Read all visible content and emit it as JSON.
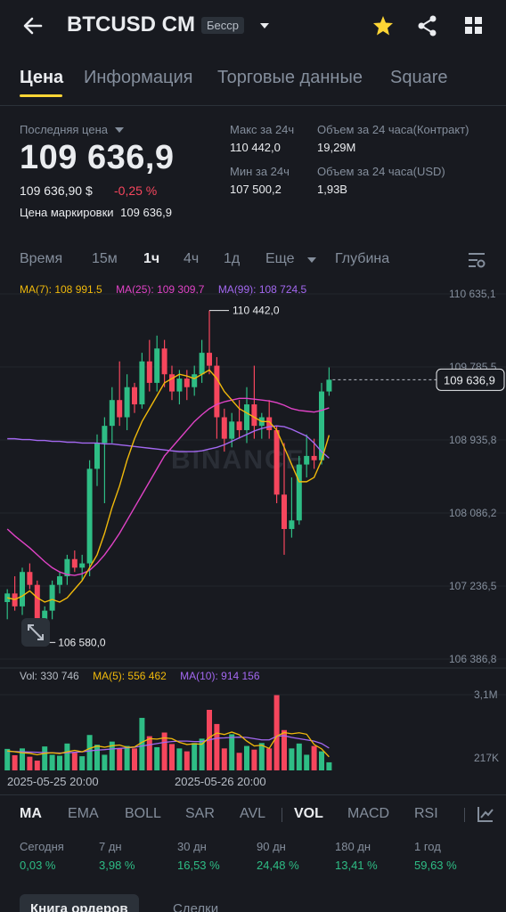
{
  "header": {
    "title": "BTCUSD CM",
    "badge": "Бесср"
  },
  "tabs": [
    "Цена",
    "Информация",
    "Торговые данные",
    "Square"
  ],
  "stats": {
    "last_price_label": "Последняя цена",
    "last_price": "109 636,9",
    "price_usd": "109 636,90 $",
    "change": "-0,25 %",
    "mark_label": "Цена маркировки",
    "mark_value": "109 636,9",
    "high_label": "Макс за 24ч",
    "high_value": "110 442,0",
    "low_label": "Мин за 24ч",
    "low_value": "107 500,2",
    "vol_contract_label": "Объем за 24 часа(Контракт)",
    "vol_contract_value": "19,29M",
    "vol_usd_label": "Объем за 24 часа(USD)",
    "vol_usd_value": "1,93B"
  },
  "timeframes": [
    "Время",
    "15м",
    "1ч",
    "4ч",
    "1д",
    "Еще",
    "Глубина"
  ],
  "active_timeframe": "1ч",
  "ma_legend": {
    "ma7": "MA(7): 108 991,5",
    "ma25": "MA(25): 109 309,7",
    "ma99": "MA(99): 108 724,5"
  },
  "watermark": "BINANCE",
  "vol_legend": {
    "vol": "Vol: 330 746",
    "ma5": "MA(5): 556 462",
    "ma10": "MA(10): 914 156"
  },
  "dates": [
    "2025-05-25 20:00",
    "2025-05-26 20:00"
  ],
  "indicators": [
    "MA",
    "EMA",
    "BOLL",
    "SAR",
    "AVL",
    "VOL",
    "MACD",
    "RSI"
  ],
  "performance": [
    {
      "label": "Сегодня",
      "value": "0,03 %"
    },
    {
      "label": "7 дн",
      "value": "3,98 %"
    },
    {
      "label": "30 дн",
      "value": "16,53 %"
    },
    {
      "label": "90 дн",
      "value": "24,48 %"
    },
    {
      "label": "180 дн",
      "value": "13,41 %"
    },
    {
      "label": "1 год",
      "value": "59,63 %"
    }
  ],
  "bottom_tabs": [
    "Книга ордеров",
    "Сделки"
  ],
  "colors": {
    "up": "#2ebd85",
    "down": "#f6465d",
    "ma7": "#f0b90b",
    "ma25": "#e043c6",
    "ma99": "#a368f0",
    "accent": "#fcd535"
  },
  "chart_data": {
    "type": "candlestick",
    "title": "",
    "price_axis_labels": [
      "110 635,1",
      "109 785,5",
      "108 935,8",
      "108 086,2",
      "107 236,5",
      "106 386,8"
    ],
    "price_axis_values": [
      110635.1,
      109785.5,
      108935.8,
      108086.2,
      107236.5,
      106386.8
    ],
    "current_price_label": "109 636,9",
    "current_price": 109636.9,
    "high_annotation": "110 442,0",
    "high_value": 110442.0,
    "low_annotation": "106 580,0",
    "low_value": 106580.0,
    "volume_axis_labels": [
      "3,1M",
      "217K"
    ],
    "volume_axis_values": [
      3100000,
      217000
    ],
    "candles": [
      {
        "o": 107050,
        "h": 107200,
        "l": 106850,
        "c": 107150
      },
      {
        "o": 107150,
        "h": 107350,
        "l": 106950,
        "c": 107000
      },
      {
        "o": 107000,
        "h": 107450,
        "l": 106900,
        "c": 107400
      },
      {
        "o": 107400,
        "h": 107500,
        "l": 107200,
        "c": 107250
      },
      {
        "o": 107250,
        "h": 107300,
        "l": 106650,
        "c": 106750
      },
      {
        "o": 106750,
        "h": 107000,
        "l": 106580,
        "c": 106950
      },
      {
        "o": 106950,
        "h": 107300,
        "l": 106850,
        "c": 107250
      },
      {
        "o": 107250,
        "h": 107400,
        "l": 107150,
        "c": 107350
      },
      {
        "o": 107350,
        "h": 107600,
        "l": 107250,
        "c": 107550
      },
      {
        "o": 107550,
        "h": 107650,
        "l": 107400,
        "c": 107450
      },
      {
        "o": 107450,
        "h": 107600,
        "l": 107300,
        "c": 107500
      },
      {
        "o": 107500,
        "h": 108700,
        "l": 107350,
        "c": 108600
      },
      {
        "o": 108600,
        "h": 109000,
        "l": 108400,
        "c": 108900
      },
      {
        "o": 108900,
        "h": 109200,
        "l": 108200,
        "c": 109100
      },
      {
        "o": 109100,
        "h": 109550,
        "l": 108900,
        "c": 109400
      },
      {
        "o": 109400,
        "h": 109850,
        "l": 109100,
        "c": 109200
      },
      {
        "o": 109200,
        "h": 109700,
        "l": 109050,
        "c": 109550
      },
      {
        "o": 109550,
        "h": 109600,
        "l": 109250,
        "c": 109350
      },
      {
        "o": 109350,
        "h": 109950,
        "l": 109300,
        "c": 109850
      },
      {
        "o": 109850,
        "h": 110100,
        "l": 109500,
        "c": 109600
      },
      {
        "o": 109600,
        "h": 110150,
        "l": 109500,
        "c": 110000
      },
      {
        "o": 110000,
        "h": 110100,
        "l": 109550,
        "c": 109700
      },
      {
        "o": 109700,
        "h": 109800,
        "l": 109400,
        "c": 109500
      },
      {
        "o": 109500,
        "h": 109750,
        "l": 109350,
        "c": 109650
      },
      {
        "o": 109650,
        "h": 109750,
        "l": 109400,
        "c": 109550
      },
      {
        "o": 109550,
        "h": 109800,
        "l": 109450,
        "c": 109700
      },
      {
        "o": 109700,
        "h": 110100,
        "l": 109600,
        "c": 109950
      },
      {
        "o": 109950,
        "h": 110442,
        "l": 109700,
        "c": 109800
      },
      {
        "o": 109800,
        "h": 109900,
        "l": 108950,
        "c": 109200
      },
      {
        "o": 109200,
        "h": 109300,
        "l": 108800,
        "c": 108950
      },
      {
        "o": 108950,
        "h": 109250,
        "l": 108850,
        "c": 109150
      },
      {
        "o": 109150,
        "h": 109400,
        "l": 108950,
        "c": 109050
      },
      {
        "o": 109050,
        "h": 109550,
        "l": 108900,
        "c": 109350
      },
      {
        "o": 109350,
        "h": 109800,
        "l": 108950,
        "c": 109100
      },
      {
        "o": 109100,
        "h": 109250,
        "l": 108950,
        "c": 109200
      },
      {
        "o": 109200,
        "h": 109400,
        "l": 108950,
        "c": 109050
      },
      {
        "o": 109050,
        "h": 109100,
        "l": 108200,
        "c": 108300
      },
      {
        "o": 108300,
        "h": 108900,
        "l": 107600,
        "c": 107900
      },
      {
        "o": 107900,
        "h": 108500,
        "l": 107800,
        "c": 108000
      },
      {
        "o": 108000,
        "h": 108750,
        "l": 107950,
        "c": 108650
      },
      {
        "o": 108650,
        "h": 109000,
        "l": 108500,
        "c": 108750
      },
      {
        "o": 108750,
        "h": 108950,
        "l": 108600,
        "c": 108700
      },
      {
        "o": 108700,
        "h": 109600,
        "l": 108650,
        "c": 109500
      },
      {
        "o": 109500,
        "h": 109780,
        "l": 109450,
        "c": 109637
      }
    ],
    "ma7": [
      107100,
      107080,
      107120,
      107180,
      107100,
      107050,
      107080,
      107050,
      107100,
      107200,
      107300,
      107450,
      107600,
      107850,
      108150,
      108400,
      108700,
      108950,
      109150,
      109300,
      109450,
      109600,
      109650,
      109700,
      109680,
      109650,
      109700,
      109750,
      109650,
      109500,
      109400,
      109300,
      109250,
      109200,
      109150,
      109150,
      109050,
      108850,
      108650,
      108450,
      108450,
      108500,
      108700,
      108991.5
    ],
    "ma25": [
      107900,
      107820,
      107750,
      107680,
      107600,
      107520,
      107450,
      107400,
      107370,
      107360,
      107380,
      107420,
      107500,
      107600,
      107720,
      107850,
      108000,
      108150,
      108300,
      108450,
      108600,
      108750,
      108850,
      108950,
      109050,
      109150,
      109230,
      109300,
      109350,
      109380,
      109400,
      109420,
      109420,
      109410,
      109400,
      109390,
      109370,
      109340,
      109300,
      109280,
      109270,
      109260,
      109280,
      109309.7
    ],
    "ma99": [
      108950,
      108950,
      108940,
      108940,
      108930,
      108930,
      108920,
      108920,
      108910,
      108910,
      108900,
      108900,
      108900,
      108890,
      108890,
      108880,
      108870,
      108860,
      108850,
      108840,
      108830,
      108820,
      108810,
      108800,
      108800,
      108800,
      108810,
      108830,
      108850,
      108880,
      108920,
      108960,
      109000,
      109040,
      109070,
      109090,
      109100,
      109090,
      109060,
      109020,
      108980,
      108900,
      108800,
      108724.5
    ],
    "volumes": [
      880000,
      620000,
      900000,
      560000,
      400000,
      980000,
      640000,
      600000,
      1100000,
      720000,
      580000,
      1450000,
      1050000,
      640000,
      1180000,
      900000,
      1000000,
      900000,
      2150000,
      1400000,
      950000,
      1550000,
      1080000,
      900000,
      780000,
      1120000,
      1300000,
      2480000,
      1900000,
      900000,
      1480000,
      720000,
      1000000,
      850000,
      1120000,
      900000,
      3100000,
      1650000,
      900000,
      1100000,
      640000,
      1000000,
      780000,
      330746
    ],
    "vol_ma5": [
      800000,
      760000,
      720000,
      700000,
      640000,
      700000,
      720000,
      690000,
      760000,
      820000,
      760000,
      900000,
      1000000,
      950000,
      1010000,
      1040000,
      940000,
      960000,
      1150000,
      1300000,
      1280000,
      1330000,
      1300000,
      1150000,
      1060000,
      1090000,
      1070000,
      1350000,
      1530000,
      1470000,
      1570000,
      1460000,
      1200000,
      1000000,
      1030000,
      900000,
      1400000,
      1550000,
      1500000,
      1540000,
      1480000,
      1060000,
      880000,
      556462
    ],
    "vol_ma10": [
      780000,
      770000,
      760000,
      750000,
      740000,
      730000,
      720000,
      710000,
      720000,
      740000,
      760000,
      800000,
      830000,
      850000,
      880000,
      900000,
      920000,
      950000,
      1000000,
      1050000,
      1100000,
      1150000,
      1180000,
      1200000,
      1200000,
      1180000,
      1180000,
      1250000,
      1320000,
      1330000,
      1350000,
      1360000,
      1350000,
      1300000,
      1250000,
      1250000,
      1400000,
      1420000,
      1350000,
      1300000,
      1250000,
      1200000,
      1100000,
      914156
    ]
  }
}
